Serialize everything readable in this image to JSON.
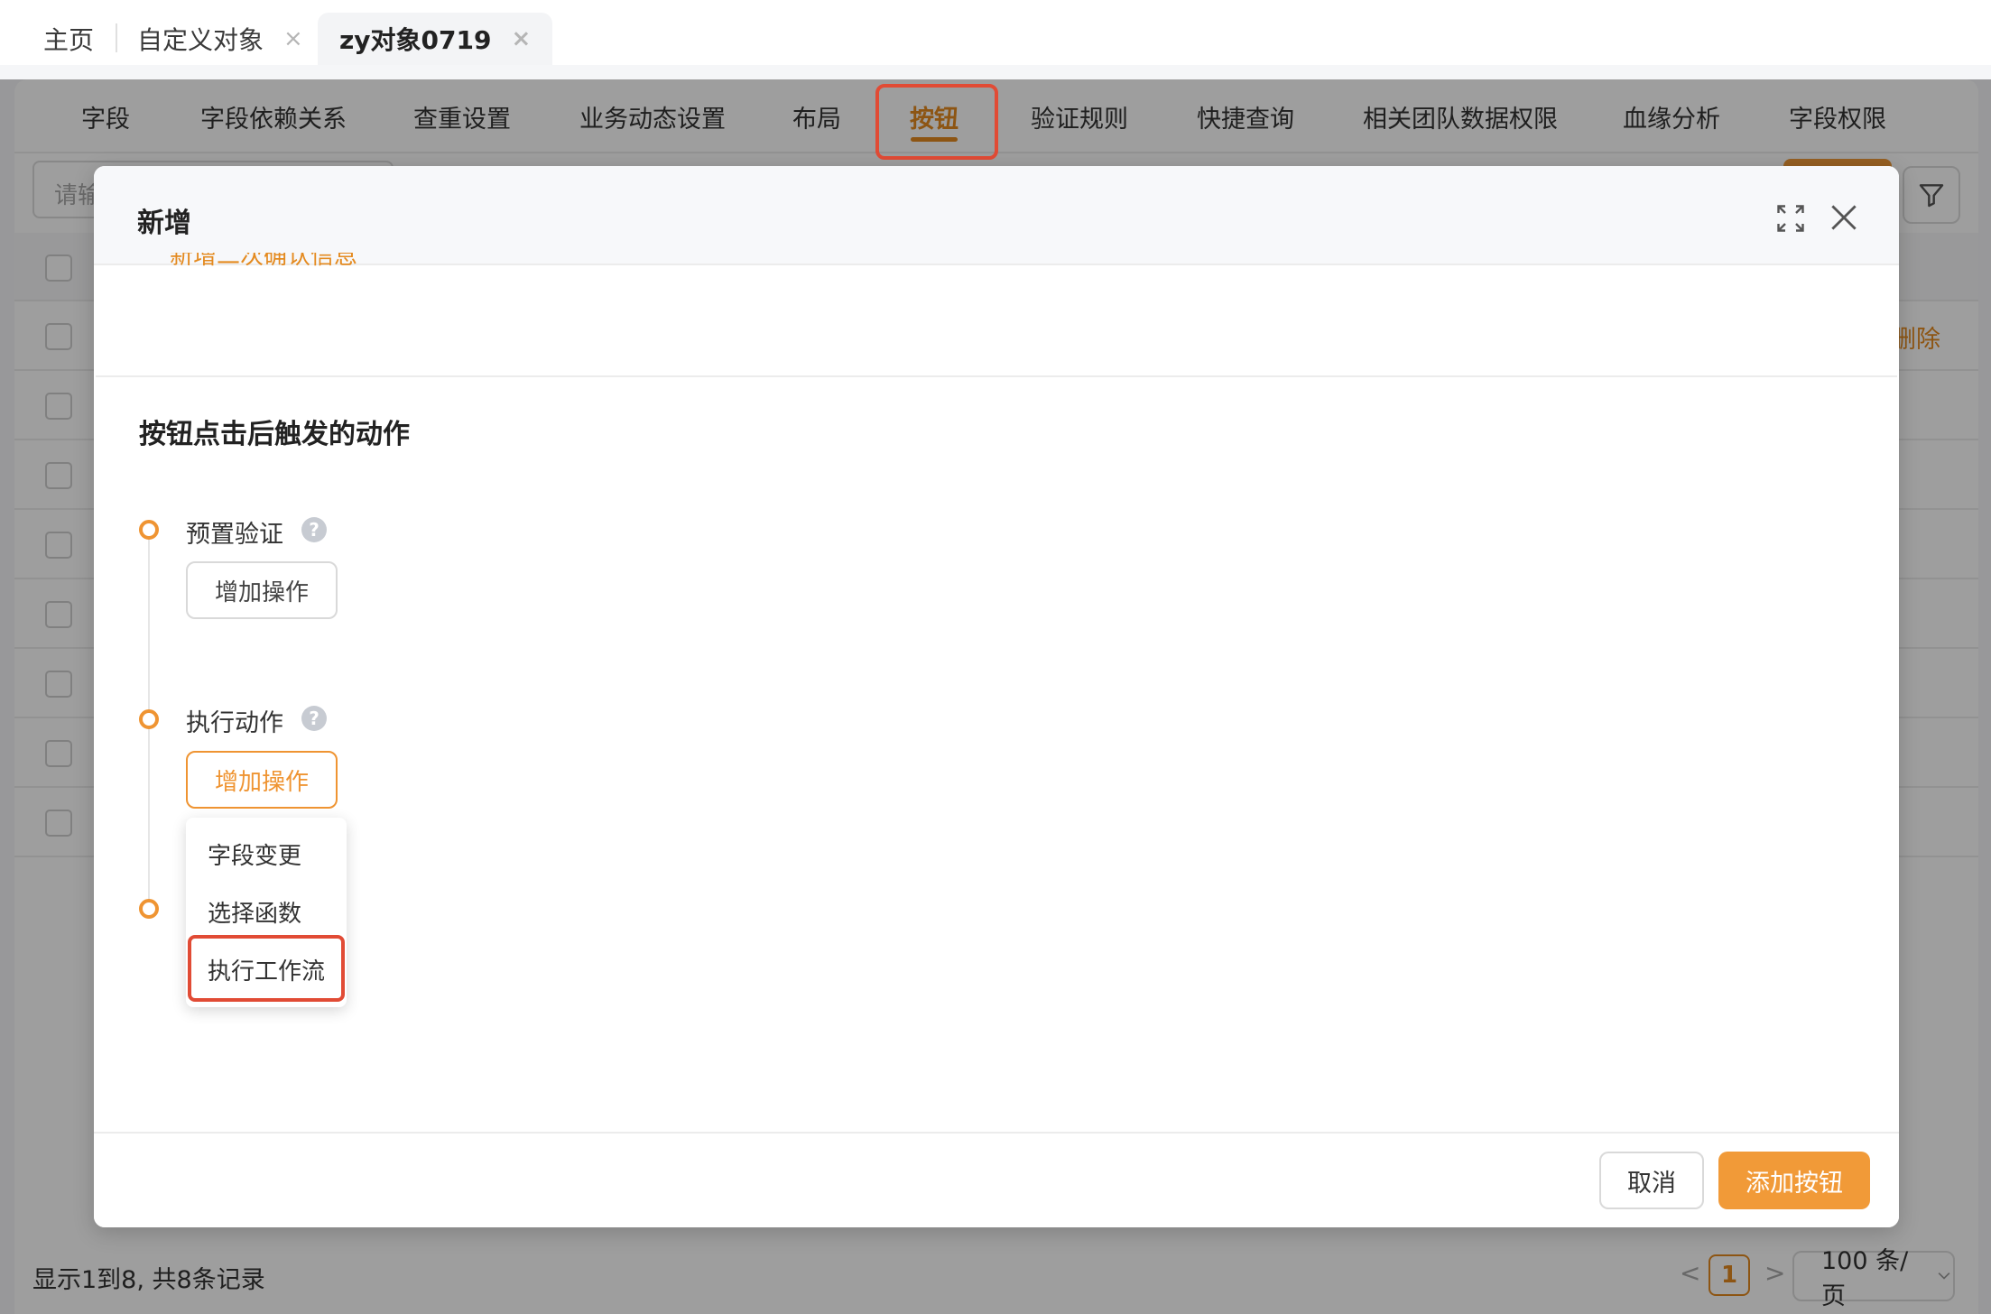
{
  "page_tabs": [
    {
      "label": "主页",
      "closable": false
    },
    {
      "label": "自定义对象",
      "closable": true
    },
    {
      "label": "zy对象0719",
      "closable": true,
      "active": true
    }
  ],
  "close_glyph": "×",
  "sub_tabs": [
    "字段",
    "字段依赖关系",
    "查重设置",
    "业务动态设置",
    "布局",
    "按钮",
    "验证规则",
    "快捷查询",
    "相关团队数据权限",
    "血缘分析",
    "字段权限"
  ],
  "active_sub_tab": "按钮",
  "search": {
    "placeholder": "请输"
  },
  "table": {
    "row_action": "删除"
  },
  "footer": {
    "info": "显示1到8, 共8条记录",
    "current_page": "1",
    "prev_glyph": "<",
    "next_glyph": ">",
    "page_size": "100 条/页"
  },
  "modal": {
    "title": "新增",
    "cutoff_text": "新增二次确认信息",
    "section_title": "按钮点击后触发的动作",
    "steps": [
      {
        "label": "预置验证",
        "help": "?",
        "button": "增加操作"
      },
      {
        "label": "执行动作",
        "help": "?",
        "button": "增加操作"
      }
    ],
    "dropdown": [
      "字段变更",
      "选择函数",
      "执行工作流"
    ],
    "cancel": "取消",
    "confirm": "添加按钮"
  },
  "colors": {
    "accent": "#ef9432",
    "highlight": "#e14b35"
  },
  "icons": [
    "close-icon",
    "maximize-icon",
    "filter-icon",
    "help-icon"
  ]
}
